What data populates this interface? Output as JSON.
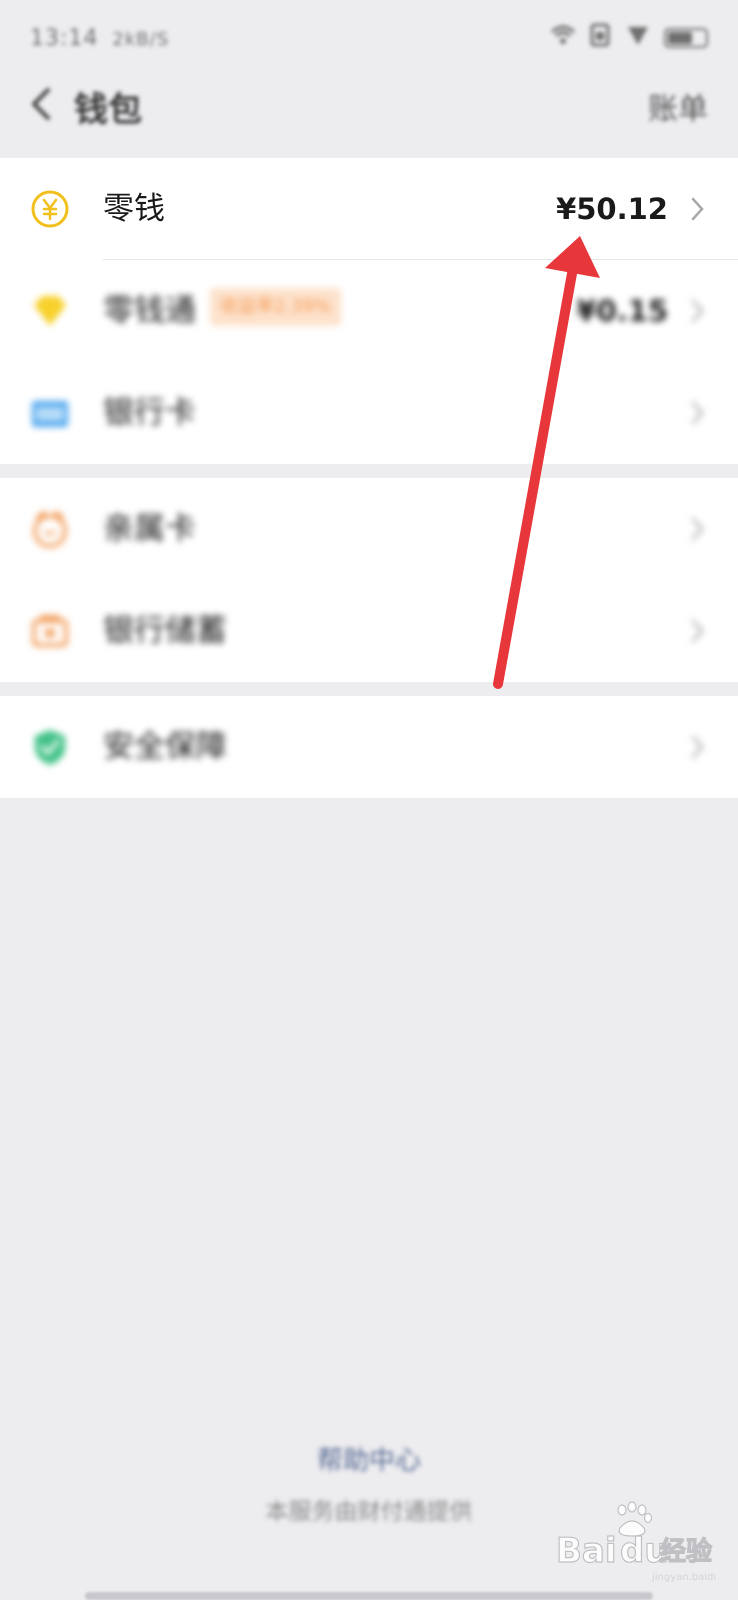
{
  "status_bar": {
    "time": "13:14",
    "network_speed": "2kB/S",
    "icons": [
      "wifi-icon",
      "sim-icon",
      "signal-icon",
      "battery-icon"
    ]
  },
  "nav": {
    "title": "钱包",
    "bills_label": "账单",
    "back_icon": "chevron-left-icon"
  },
  "groups": [
    {
      "items": [
        {
          "label": "零钱",
          "value": "¥50.12",
          "icon": "yuan-coin-icon",
          "icon_color": "#f2c01d"
        },
        {
          "label": "零钱通",
          "tag": "收益率2.39%",
          "value": "¥0.15",
          "icon": "diamond-icon",
          "icon_color": "#f7d12b"
        },
        {
          "label": "银行卡",
          "value": "",
          "icon": "bank-card-icon",
          "icon_color": "#4fa7ee"
        }
      ]
    },
    {
      "items": [
        {
          "label": "亲属卡",
          "value": "",
          "icon": "family-card-icon",
          "icon_color": "#f3a161"
        },
        {
          "label": "银行储蓄",
          "value": "",
          "icon": "savings-icon",
          "icon_color": "#f3a161"
        }
      ]
    },
    {
      "items": [
        {
          "label": "安全保障",
          "value": "",
          "icon": "shield-check-icon",
          "icon_color": "#42c287"
        }
      ]
    }
  ],
  "footer": {
    "help_center": "帮助中心",
    "provider": "本服务由财付通提供"
  },
  "watermark": {
    "brand": "Bai du 经验",
    "url": "jingyan.baidu.com"
  },
  "annotation": {
    "color": "#e8373b"
  }
}
